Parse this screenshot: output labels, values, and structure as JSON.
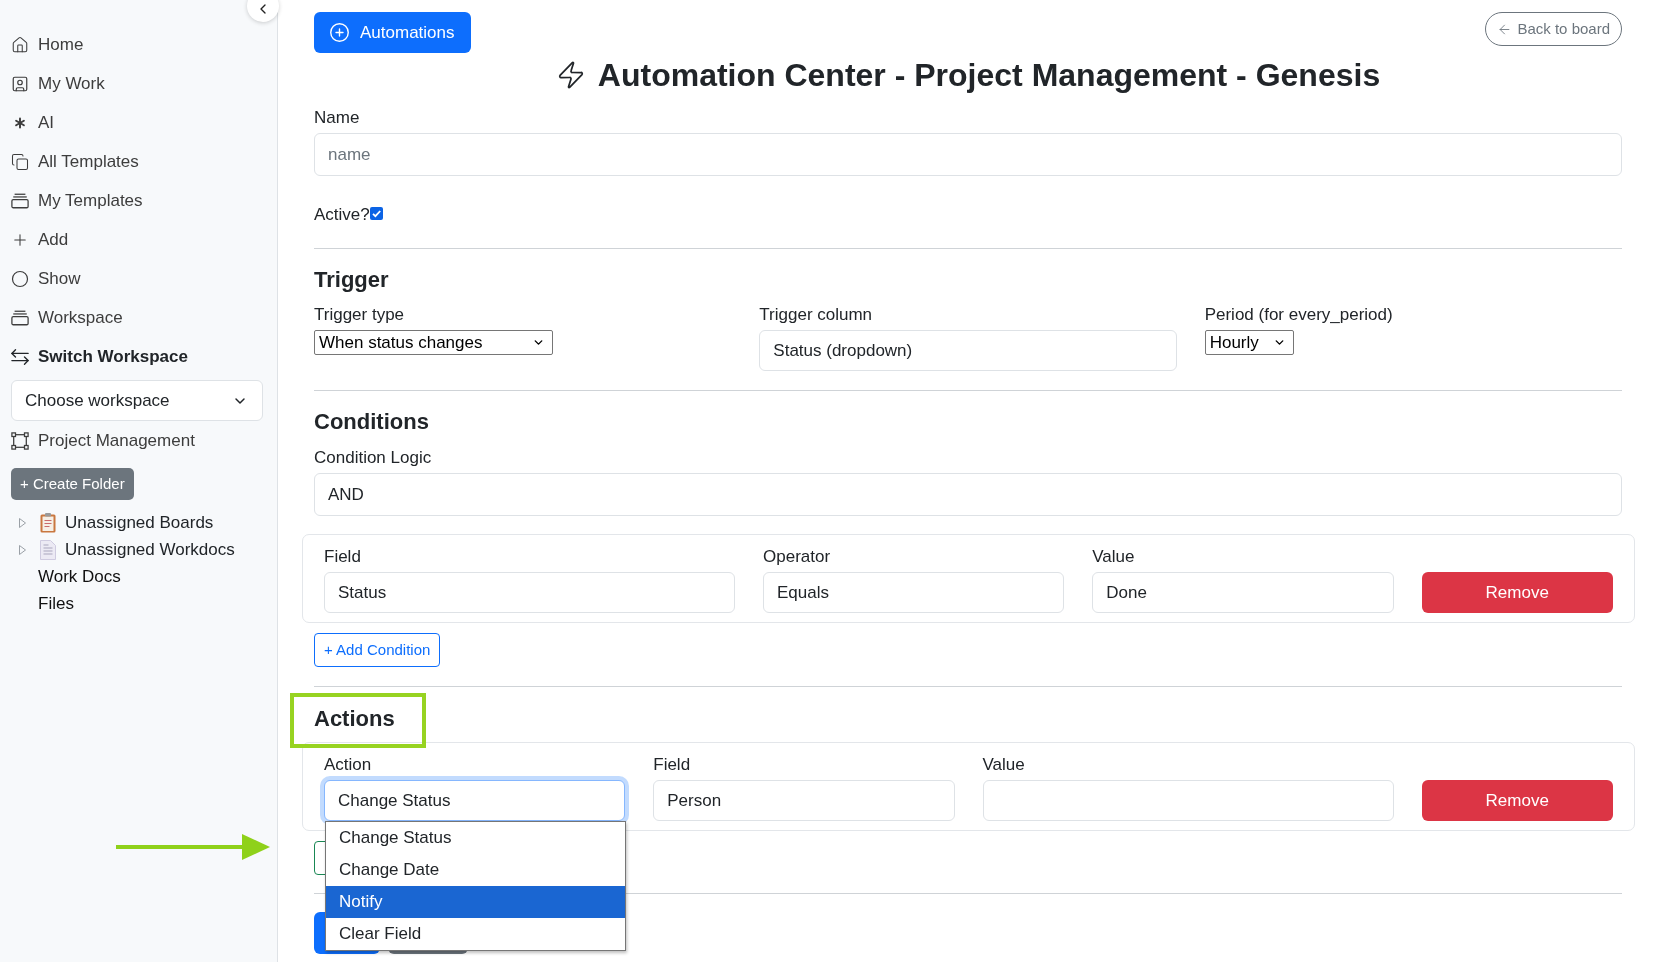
{
  "sidebar": {
    "nav_items": [
      {
        "label": "Home",
        "kind": "link"
      },
      {
        "label": "My Work",
        "kind": "link"
      },
      {
        "label": "AI",
        "kind": "link"
      },
      {
        "label": "All Templates",
        "kind": "link"
      },
      {
        "label": "My Templates",
        "kind": "link"
      },
      {
        "label": "Add",
        "kind": "link"
      },
      {
        "label": "Show",
        "kind": "link"
      },
      {
        "label": "Workspace",
        "kind": "link"
      },
      {
        "label": "Switch Workspace",
        "kind": "header"
      }
    ],
    "workspace_select": {
      "value": "Choose workspace"
    },
    "project": {
      "label": "Project Management"
    },
    "create_folder_button": "+ Create Folder",
    "tree": [
      {
        "label": "Unassigned Boards",
        "kind": "board",
        "expanded": false
      },
      {
        "label": "Unassigned Workdocs",
        "kind": "doc",
        "expanded": false
      },
      {
        "label": "Work Docs",
        "kind": "link"
      },
      {
        "label": "Files",
        "kind": "link"
      }
    ]
  },
  "header": {
    "automations_button": "Automations",
    "back_button": "Back to board",
    "title": "Automation Center - Project Management - Genesis"
  },
  "form": {
    "name": {
      "label": "Name",
      "placeholder": "name"
    },
    "active": {
      "label": "Active?",
      "checked": true
    }
  },
  "trigger": {
    "heading": "Trigger",
    "fields": [
      {
        "label": "Trigger type",
        "kind": "select",
        "value": "When status changes"
      },
      {
        "label": "Trigger column",
        "kind": "input",
        "value": "Status (dropdown)"
      },
      {
        "label": "Period (for every_period)",
        "kind": "select",
        "value": "Hourly"
      }
    ]
  },
  "conditions": {
    "heading": "Conditions",
    "logic": {
      "label": "Condition Logic",
      "value": "AND"
    },
    "rows": [
      {
        "fields": [
          {
            "label": "Field",
            "value": "Status",
            "focused": false
          },
          {
            "label": "Operator",
            "value": "Equals",
            "focused": false
          },
          {
            "label": "Value",
            "value": "Done",
            "focused": false
          }
        ],
        "remove_button": "Remove"
      }
    ],
    "add_button": "+ Add Condition"
  },
  "actions": {
    "heading": "Actions",
    "highlighted": true,
    "rows": [
      {
        "fields": [
          {
            "label": "Action",
            "value": "Change Status",
            "focused": true
          },
          {
            "label": "Field",
            "value": "Person",
            "focused": false
          },
          {
            "label": "Value",
            "focused": false
          }
        ],
        "remove_button": "Remove"
      }
    ],
    "dropdown": {
      "options": [
        {
          "label": "Change Status",
          "selected": false
        },
        {
          "label": "Change Date",
          "selected": false
        },
        {
          "label": "Notify",
          "selected": true
        },
        {
          "label": "Clear Field",
          "selected": false
        }
      ]
    }
  }
}
